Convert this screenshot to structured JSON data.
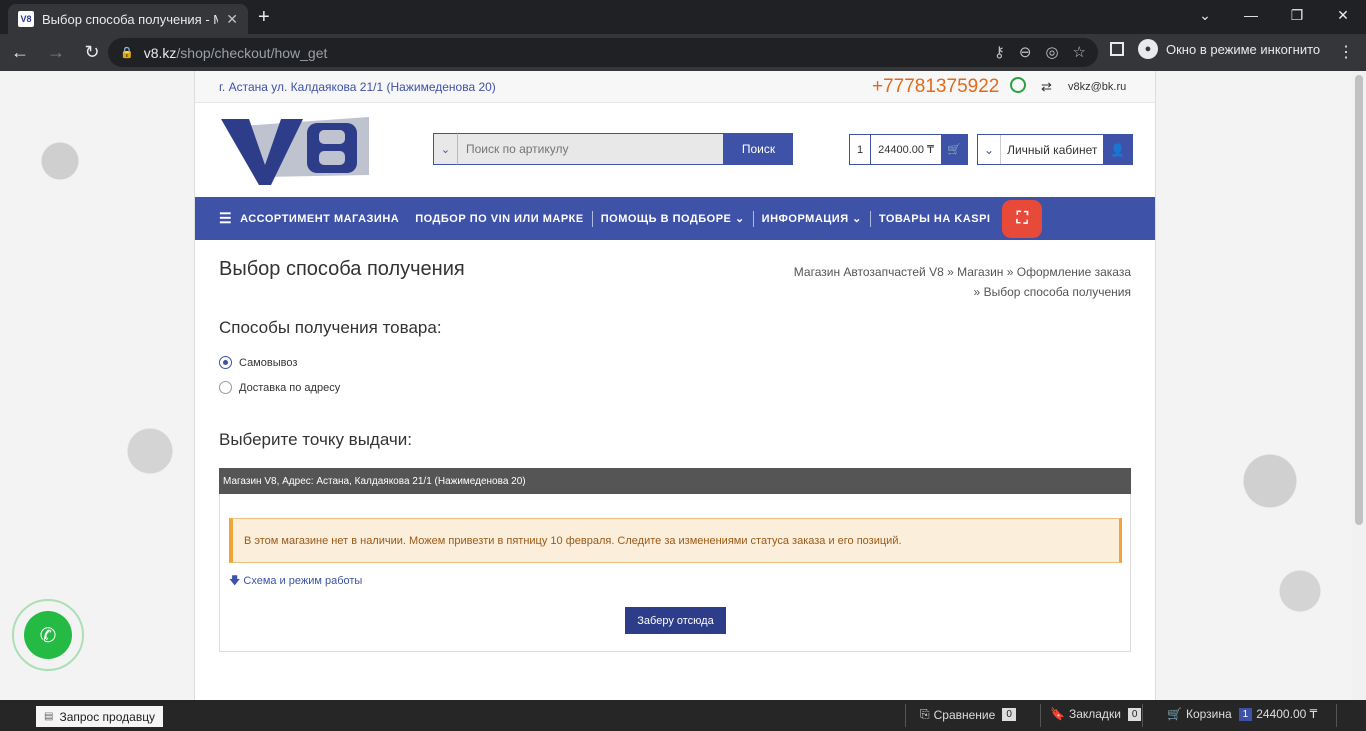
{
  "browser": {
    "tab_title": "Выбор способа получения - Ма",
    "favicon_text": "V8",
    "url_host": "v8.kz",
    "url_path": "/shop/checkout/how_get",
    "incognito_label": "Окно в режиме инкогнито"
  },
  "topbar": {
    "address": "г. Астана ул. Калдаякова 21/1 (Нажимеденова 20)",
    "phone": "+77781375922",
    "email": "v8kz@bk.ru"
  },
  "header": {
    "search_placeholder": "Поиск по артикулу",
    "search_button": "Поиск",
    "cart_count": "1",
    "cart_total": "24400.00 ₸",
    "account_label": "Личный кабинет"
  },
  "nav": {
    "items": [
      {
        "label": "АССОРТИМЕНТ МАГАЗИНА"
      },
      {
        "label": "ПОДБОР ПО VIN ИЛИ МАРКЕ"
      },
      {
        "label": "ПОМОЩЬ В ПОДБОРЕ"
      },
      {
        "label": "ИНФОРМАЦИЯ"
      },
      {
        "label": "ТОВАРЫ НА KASPI"
      }
    ]
  },
  "main": {
    "page_title": "Выбор способа получения",
    "breadcrumb": [
      "Магазин Автозапчастей V8",
      "Магазин",
      "Оформление заказа",
      "Выбор способа получения"
    ],
    "methods_heading": "Способы получения товара:",
    "methods": [
      {
        "label": "Самовывоз",
        "selected": true
      },
      {
        "label": "Доставка по адресу",
        "selected": false
      }
    ],
    "point_heading": "Выберите точку выдачи:",
    "store_title": "Магазин V8, Адрес: Астана, Калдаякова 21/1 (Нажимеденова 20)",
    "store_alert": "В этом магазине нет в наличии. Можем привезти в пятницу 10 февраля. Следите за изменениями статуса заказа и его позиций.",
    "schema_link": "Схема и режим работы",
    "pickup_button": "Заберу отсюда"
  },
  "bottombar": {
    "seller_request": "Запрос продавцу",
    "compare_label": "Сравнение",
    "compare_count": "0",
    "bookmarks_label": "Закладки",
    "bookmarks_count": "0",
    "cart_label": "Корзина",
    "cart_count": "1",
    "cart_total": "24400.00 ₸"
  },
  "colors": {
    "brand": "#3e52a8",
    "phone": "#e26a1b",
    "alert_bg": "#fbeedb",
    "kaspi": "#e84a3a"
  }
}
